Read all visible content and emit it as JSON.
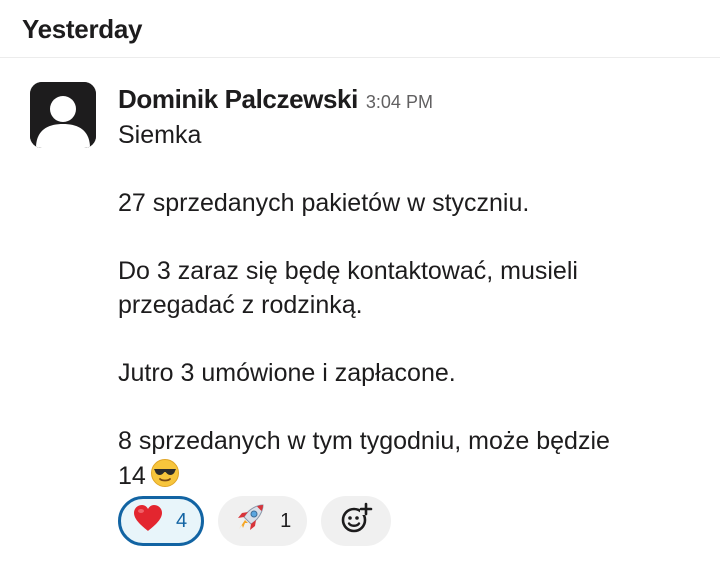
{
  "day_divider": {
    "label": "Yesterday"
  },
  "message": {
    "author": "Dominik Palczewski",
    "timestamp": "3:04 PM",
    "paragraphs": [
      {
        "lines": [
          "Siemka"
        ]
      },
      {
        "lines": [
          "27 sprzedanych pakietów w styczniu."
        ]
      },
      {
        "lines": [
          "Do 3 zaraz się będę kontaktować, musieli",
          "przegadać z rodzinką."
        ]
      },
      {
        "lines": [
          "Jutro 3 umówione i zapłacone."
        ]
      },
      {
        "lines": [
          "8 sprzedanych w tym tygodniu, może będzie",
          "14"
        ]
      }
    ],
    "trailing_emoji": "smiling-face-with-sunglasses"
  },
  "reactions": [
    {
      "emoji": "red-heart",
      "count": "4",
      "selected": true
    },
    {
      "emoji": "rocket",
      "count": "1",
      "selected": false
    }
  ],
  "add_reaction": {
    "icon": "add-reaction-icon"
  },
  "colors": {
    "text": "#1d1c1d",
    "muted": "#616061",
    "selected_border": "#1264a3",
    "selected_bg": "#e8f5fa",
    "pill_bg": "#f0f0f0"
  }
}
